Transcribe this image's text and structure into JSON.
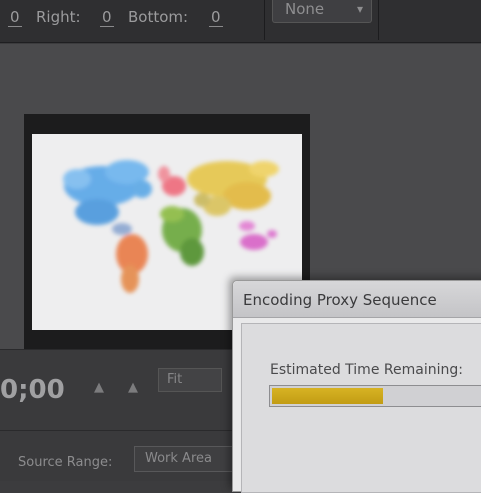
{
  "crop": {
    "top_value": "0",
    "right_label": "Right:",
    "right_value": "0",
    "bottom_label": "Bottom:",
    "bottom_value": "0"
  },
  "scaling": {
    "selected": "None"
  },
  "controls": {
    "timecode": "0;00",
    "fit_label": "Fit",
    "source_range_label": "Source Range:",
    "source_range_value": "Work Area"
  },
  "dialog": {
    "title": "Encoding Proxy Sequence",
    "estimated_label": "Estimated Time Remaining:",
    "progress_fraction": 0.56
  },
  "colors": {
    "progress_fill": "#d7b324",
    "panel_bg": "#4a4a4c"
  },
  "icons": [
    "triangle-left-icon",
    "triangle-right-icon",
    "chevron-down-icon"
  ]
}
